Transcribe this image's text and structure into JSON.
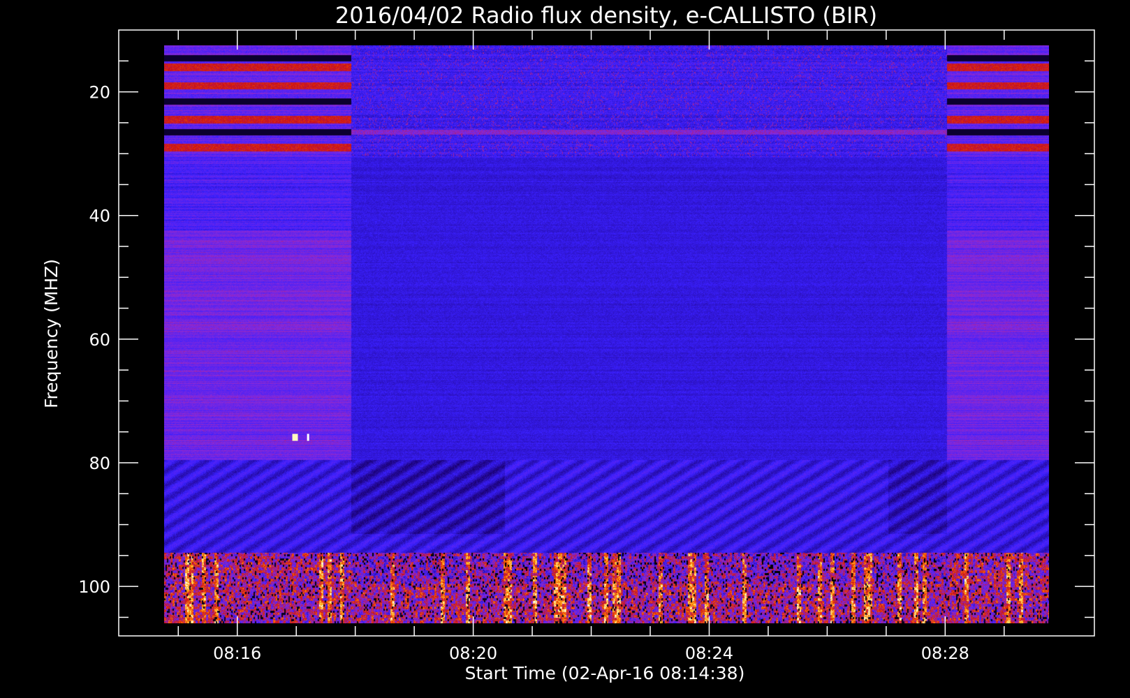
{
  "chart_data": {
    "type": "heatmap",
    "title": "2016/04/02  Radio flux density, e-CALLISTO (BIR)",
    "xlabel": "Start Time (02-Apr-16 08:14:38)",
    "ylabel": "Frequency (MHZ)",
    "x_unit": "minutes after 08:14:38 UT",
    "xlim": [
      -0.6,
      12.7
    ],
    "ylim": [
      108,
      10
    ],
    "data_x_range": [
      0.13,
      15.13
    ],
    "data_y_range": [
      12.5,
      106
    ],
    "x_ticks": [
      {
        "label": "08:16",
        "value": 1.37
      },
      {
        "label": "08:20",
        "value": 5.37
      },
      {
        "label": "08:24",
        "value": 9.37
      },
      {
        "label": "08:28",
        "value": 13.37
      }
    ],
    "y_ticks": [
      {
        "label": "20",
        "value": 20
      },
      {
        "label": "40",
        "value": 40
      },
      {
        "label": "60",
        "value": 60
      },
      {
        "label": "80",
        "value": 80
      },
      {
        "label": "100",
        "value": 100
      }
    ],
    "y_minor_step": 5,
    "x_minor_step_minutes": 1,
    "colormap": [
      "#000000",
      "#1a0070",
      "#3a20ff",
      "#8a2ad8",
      "#cc1010",
      "#ff6a00",
      "#ffd030",
      "#ffffff"
    ],
    "segments": [
      {
        "x": [
          0.13,
          3.3
        ],
        "mode": "off"
      },
      {
        "x": [
          3.3,
          13.4
        ],
        "mode": "on"
      },
      {
        "x": [
          13.4,
          15.13
        ],
        "mode": "off"
      }
    ],
    "bright_spots": [
      {
        "x": 2.35,
        "freq": 76
      },
      {
        "x": 2.6,
        "freq": 76
      }
    ]
  }
}
